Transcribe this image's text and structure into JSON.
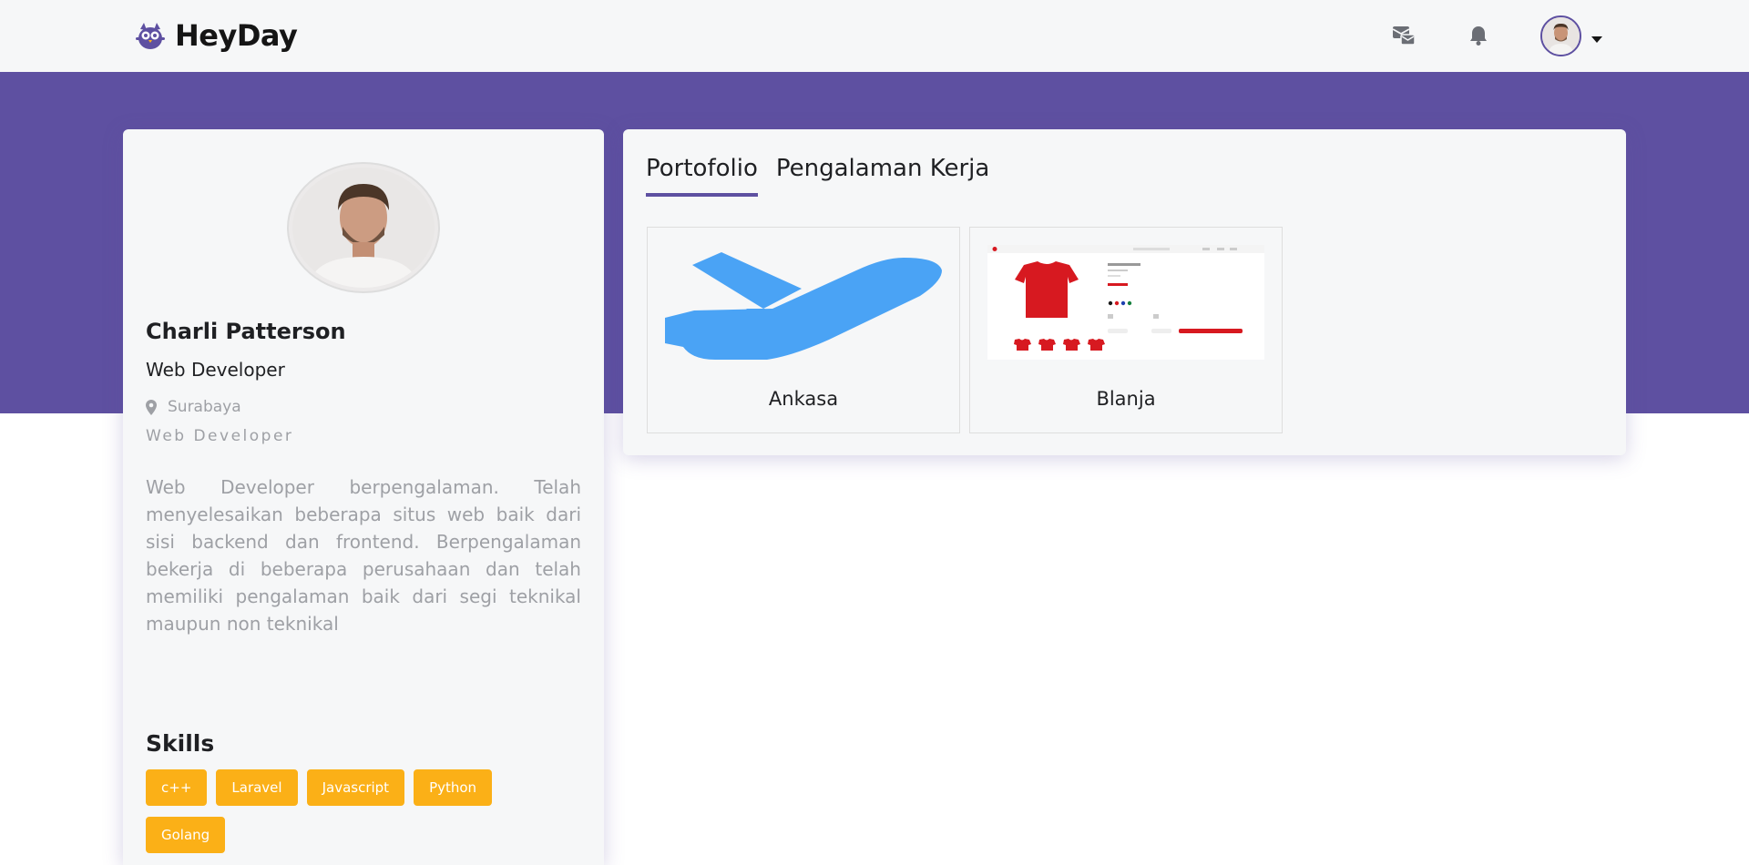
{
  "brand": {
    "name": "HeyDay"
  },
  "navbar": {
    "icons": [
      "mail-icon",
      "bell-icon"
    ],
    "avatar": "user-avatar",
    "caret": "caret-down-icon"
  },
  "profile": {
    "name": "Charli Patterson",
    "job": "Web Developer",
    "location": "Surabaya",
    "subtitle": "Web Developer",
    "description": "Web Developer berpengalaman. Telah menyelesaikan beberapa situs web baik dari sisi backend dan frontend. Berpengalaman bekerja di beberapa perusahaan dan telah memiliki pengalaman baik dari segi teknikal maupun non teknikal",
    "skills_title": "Skills",
    "skills": [
      "c++",
      "Laravel",
      "Javascript",
      "Python",
      "Golang"
    ]
  },
  "tabs": [
    {
      "label": "Portofolio",
      "active": true
    },
    {
      "label": "Pengalaman Kerja",
      "active": false
    }
  ],
  "portfolio": [
    {
      "title": "Ankasa",
      "image": "airplane-image"
    },
    {
      "title": "Blanja",
      "image": "shop-screenshot-image"
    }
  ],
  "colors": {
    "primary": "#5e50a1",
    "skill": "#fbb017",
    "airplane": "#4aa3f5",
    "shirt": "#d71920"
  }
}
